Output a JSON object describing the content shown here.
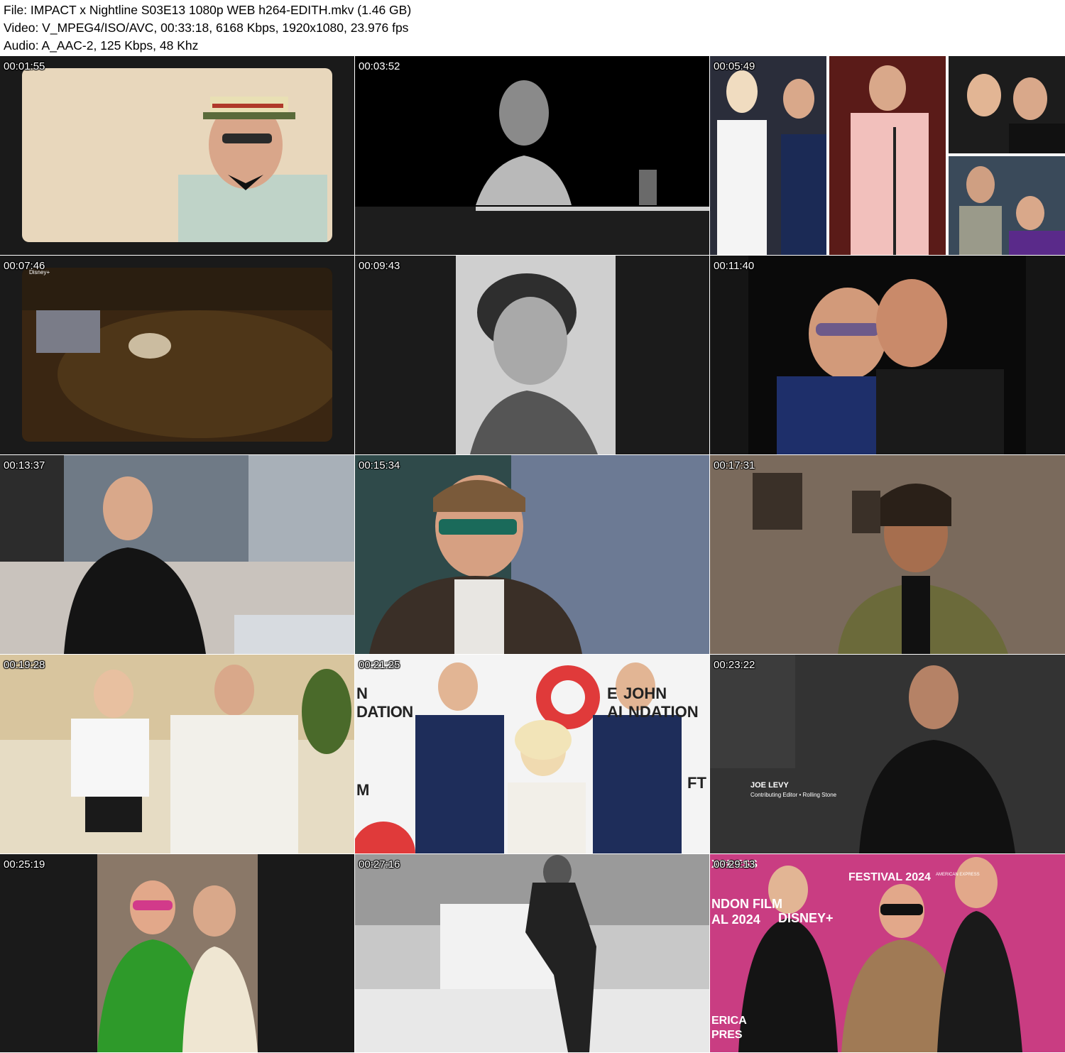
{
  "header": {
    "file_line": "File: IMPACT x Nightline S03E13 1080p WEB h264-EDITH.mkv (1.46 GB)",
    "video_line": "Video: V_MPEG4/ISO/AVC, 00:33:18, 6168 Kbps, 1920x1080, 23.976 fps",
    "audio_line": "Audio: A_AAC-2, 125 Kbps, 48 Khz"
  },
  "thumbnails": [
    {
      "timestamp": "00:01:55"
    },
    {
      "timestamp": "00:03:52"
    },
    {
      "timestamp": "00:05:49"
    },
    {
      "timestamp": "00:07:46",
      "overlay": "Disney+"
    },
    {
      "timestamp": "00:09:43"
    },
    {
      "timestamp": "00:11:40"
    },
    {
      "timestamp": "00:13:37"
    },
    {
      "timestamp": "00:15:34"
    },
    {
      "timestamp": "00:17:31"
    },
    {
      "timestamp": "00:19:28"
    },
    {
      "timestamp": "00:21:25",
      "signage": [
        "N",
        "DATION",
        "E",
        "JOHN",
        "AI",
        "NDATION",
        "M",
        "FT"
      ]
    },
    {
      "timestamp": "00:23:22",
      "lower_third_name": "JOE LEVY",
      "lower_third_title": "Contributing Editor • Rolling Stone"
    },
    {
      "timestamp": "00:25:19"
    },
    {
      "timestamp": "00:27:16"
    },
    {
      "timestamp": "00:29:13",
      "signage": [
        "XPRESS",
        "FESTIVAL 2024",
        "AMERICAN EXPRESS",
        "NDON FILM",
        "AL 2024",
        "DISNEY+",
        "ERICA",
        "PRES"
      ]
    }
  ],
  "colors": {
    "page_bg": "#ffffff",
    "text": "#000000",
    "timestamp_text": "#ffffff"
  }
}
